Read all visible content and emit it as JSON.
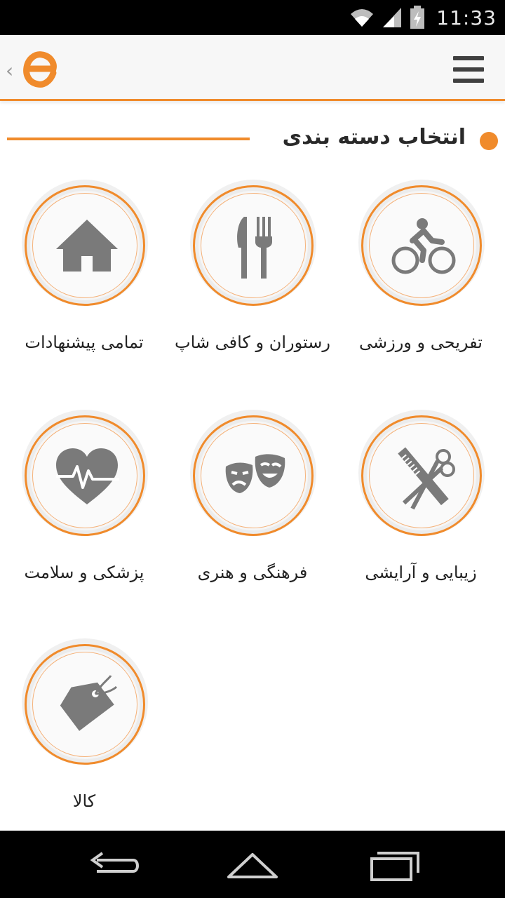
{
  "status_bar": {
    "time": "11:33",
    "icons": [
      "wifi-icon",
      "signal-icon",
      "battery-charging-icon"
    ]
  },
  "app_bar": {
    "logo": "e-logo",
    "back_icon": "chevron-left-icon",
    "menu_icon": "hamburger-menu-icon"
  },
  "section": {
    "title": "انتخاب دسته بندی"
  },
  "categories": [
    {
      "label": "تفریحی و ورزشی",
      "icon": "cyclist-icon"
    },
    {
      "label": "رستوران و کافی شاپ",
      "icon": "fork-knife-icon"
    },
    {
      "label": "تمامی پیشنهادات",
      "icon": "home-icon"
    },
    {
      "label": "زیبایی و آرایشی",
      "icon": "comb-scissors-icon"
    },
    {
      "label": "فرهنگی و هنری",
      "icon": "theater-masks-icon"
    },
    {
      "label": "پزشکی و سلامت",
      "icon": "heart-pulse-icon"
    },
    {
      "label": "کالا",
      "icon": "price-tag-icon"
    }
  ],
  "colors": {
    "accent": "#f08b2c",
    "icon_gray": "#7a7a7a",
    "text": "#222222"
  },
  "nav_bar": {
    "buttons": [
      "back-icon",
      "home-icon",
      "recent-apps-icon"
    ]
  }
}
